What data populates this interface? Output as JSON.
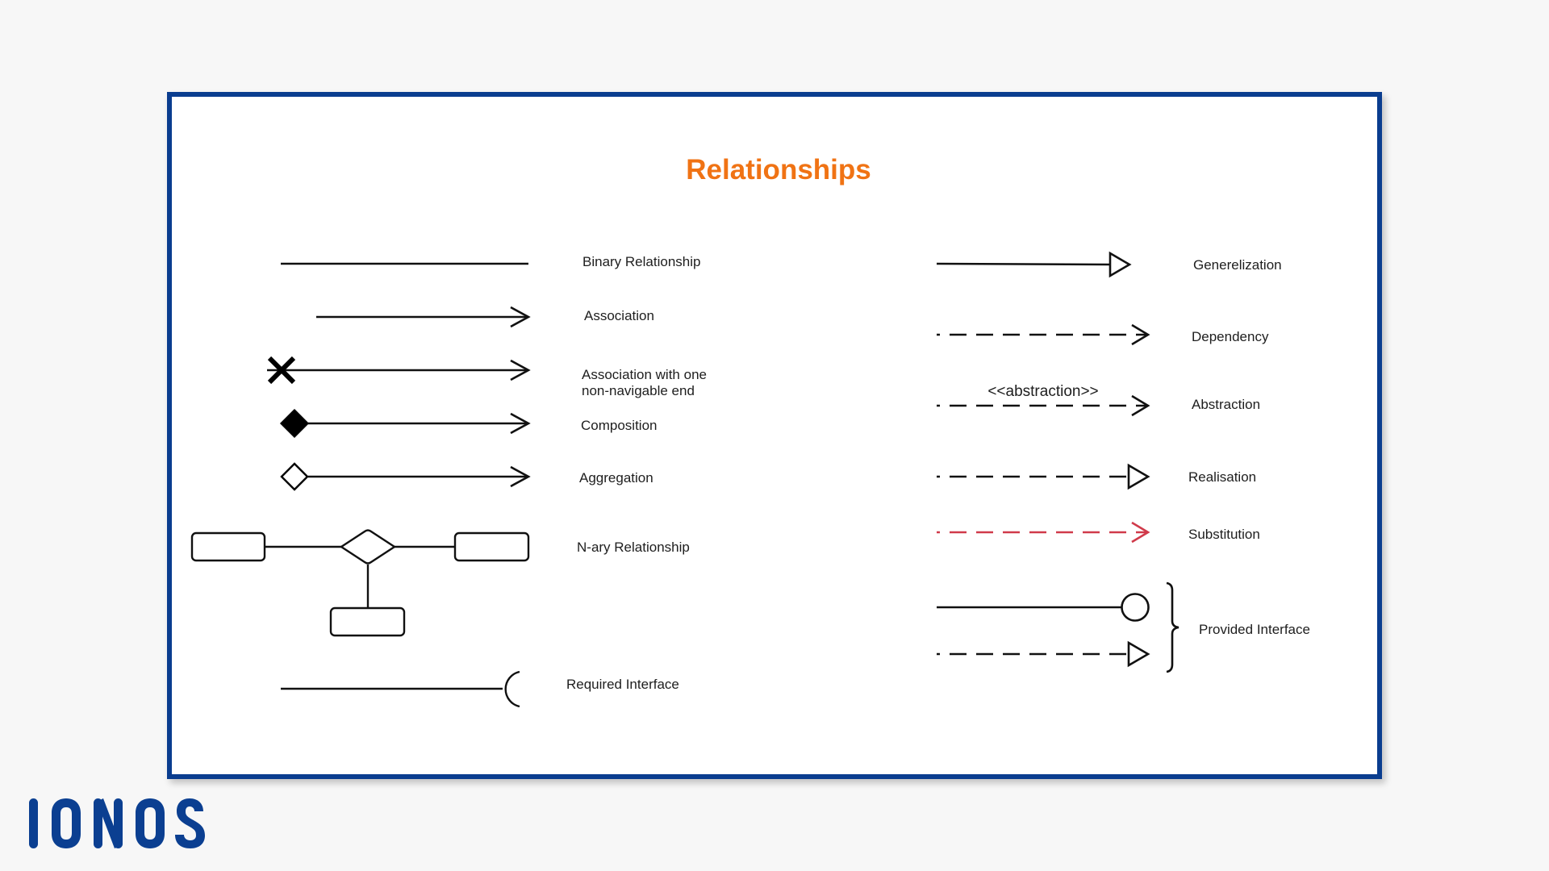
{
  "diagram": {
    "title": "Relationships",
    "left_column": [
      {
        "id": "binary",
        "label": "Binary Relationship",
        "line_style": "solid",
        "start_marker": "none",
        "end_marker": "none"
      },
      {
        "id": "association",
        "label": "Association",
        "line_style": "solid",
        "start_marker": "none",
        "end_marker": "open-arrow"
      },
      {
        "id": "association-non-navigable",
        "label_lines": [
          "Association with one",
          "non-navigable end"
        ],
        "line_style": "solid",
        "start_marker": "x-cross",
        "end_marker": "open-arrow"
      },
      {
        "id": "composition",
        "label": "Composition",
        "line_style": "solid",
        "start_marker": "filled-diamond",
        "end_marker": "open-arrow"
      },
      {
        "id": "aggregation",
        "label": "Aggregation",
        "line_style": "solid",
        "start_marker": "hollow-diamond",
        "end_marker": "open-arrow"
      },
      {
        "id": "n-ary",
        "label": "N-ary Relationship",
        "shape": "diamond-with-three-classes"
      },
      {
        "id": "required-interface",
        "label": "Required Interface",
        "line_style": "solid",
        "end_marker": "socket"
      }
    ],
    "right_column": [
      {
        "id": "generalization",
        "label": "Generelization",
        "line_style": "solid",
        "end_marker": "hollow-triangle"
      },
      {
        "id": "dependency",
        "label": "Dependency",
        "line_style": "dashed",
        "end_marker": "open-arrow"
      },
      {
        "id": "abstraction",
        "label": "Abstraction",
        "stereotype": "<<abstraction>>",
        "line_style": "dashed",
        "end_marker": "open-arrow"
      },
      {
        "id": "realisation",
        "label": "Realisation",
        "line_style": "dashed",
        "end_marker": "hollow-triangle"
      },
      {
        "id": "substitution",
        "label": "Substitution",
        "line_style": "dashed",
        "color": "#d03a4a",
        "end_marker": "open-arrow"
      },
      {
        "id": "provided-interface",
        "label": "Provided Interface",
        "variants": [
          "solid-lollipop",
          "dashed-hollow-triangle"
        ],
        "grouped_by": "curly-brace"
      }
    ]
  },
  "colors": {
    "title": "#f07314",
    "frame_border": "#0a3d8f",
    "line": "#111111",
    "substitution": "#d03a4a",
    "logo": "#0b3f91",
    "background": "#f7f7f7"
  },
  "brand": {
    "logo_text": "IONOS"
  }
}
